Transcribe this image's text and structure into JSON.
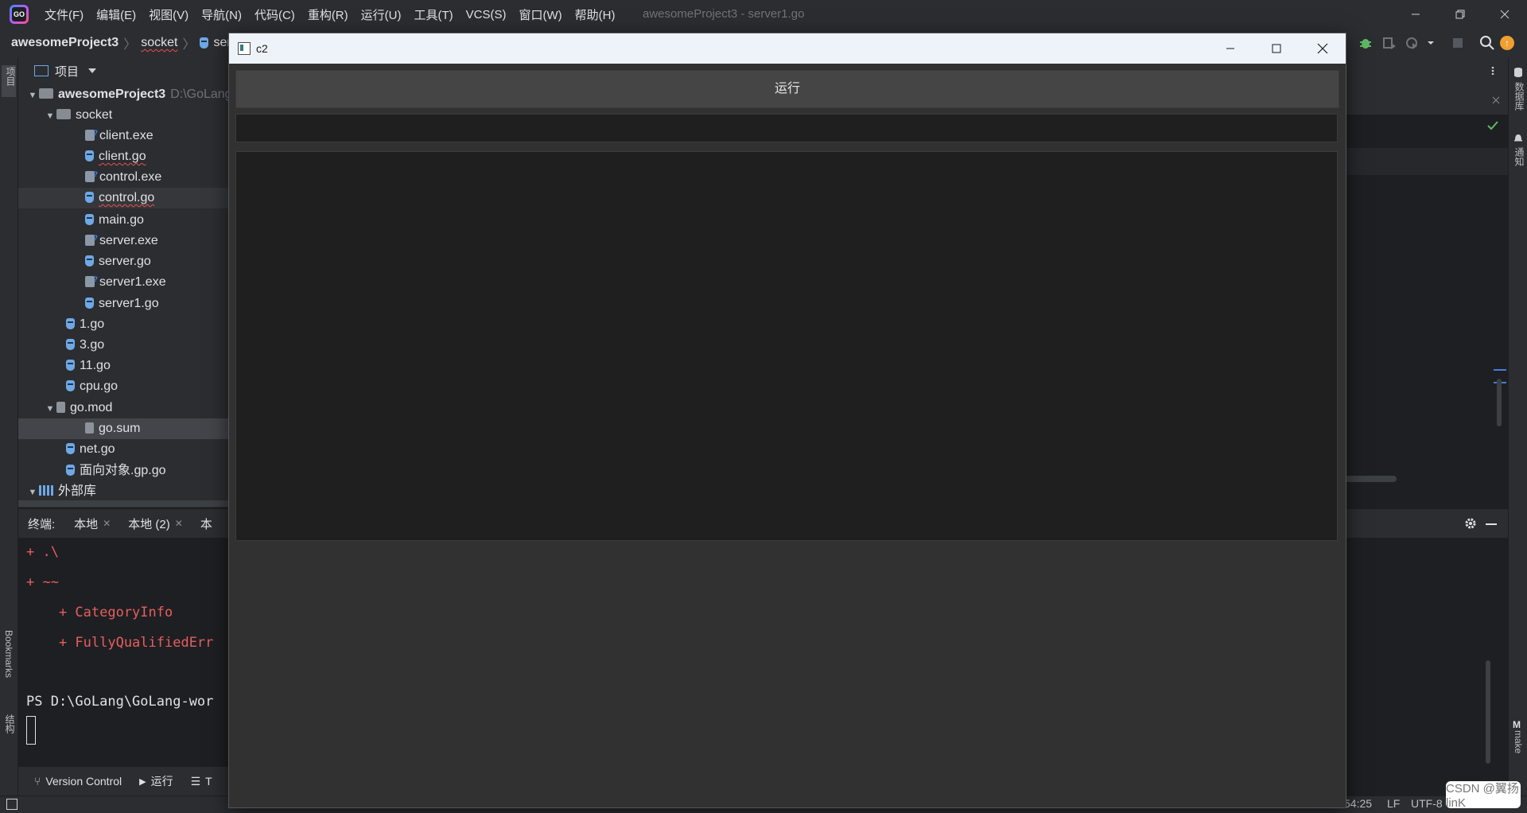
{
  "ide": {
    "logo_text": "GO",
    "menu": [
      "文件(F)",
      "编辑(E)",
      "视图(V)",
      "导航(N)",
      "代码(C)",
      "重构(R)",
      "运行(U)",
      "工具(T)",
      "VCS(S)",
      "窗口(W)",
      "帮助(H)"
    ],
    "window_title": "awesomeProject3 - server1.go",
    "breadcrumb": [
      "awesomeProject3",
      "socket",
      "serv"
    ],
    "left_stripe": {
      "project": "项目",
      "bookmarks": "Bookmarks",
      "structure": "结构"
    },
    "right_stripe": {
      "database": "数据库",
      "notifications": "通知",
      "make": "make"
    },
    "colors": {
      "accent": "#3d8bff",
      "error": "#e55f5f",
      "ok": "#5fb865"
    }
  },
  "project_panel": {
    "title": "项目",
    "root": {
      "name": "awesomeProject3",
      "path": "D:\\GoLang"
    },
    "items": [
      {
        "name": "socket",
        "kind": "folder",
        "level": 1,
        "expanded": true
      },
      {
        "name": "client.exe",
        "kind": "exe",
        "level": 2
      },
      {
        "name": "client.go",
        "kind": "go",
        "level": 2
      },
      {
        "name": "control.exe",
        "kind": "exe",
        "level": 2
      },
      {
        "name": "control.go",
        "kind": "go",
        "level": 2
      },
      {
        "name": "main.go",
        "kind": "go",
        "level": 2
      },
      {
        "name": "server.exe",
        "kind": "exe",
        "level": 2
      },
      {
        "name": "server.go",
        "kind": "go",
        "level": 2
      },
      {
        "name": "server1.exe",
        "kind": "exe",
        "level": 2
      },
      {
        "name": "server1.go",
        "kind": "go",
        "level": 2
      },
      {
        "name": "1.go",
        "kind": "go",
        "level": 1
      },
      {
        "name": "3.go",
        "kind": "go",
        "level": 1
      },
      {
        "name": "11.go",
        "kind": "go",
        "level": 1
      },
      {
        "name": "cpu.go",
        "kind": "go",
        "level": 1
      },
      {
        "name": "go.mod",
        "kind": "mod",
        "level": 1,
        "expanded": true
      },
      {
        "name": "go.sum",
        "kind": "txt",
        "level": 2,
        "selected": true
      },
      {
        "name": "net.go",
        "kind": "go",
        "level": 1
      },
      {
        "name": "面向对象.gp.go",
        "kind": "go",
        "level": 1
      },
      {
        "name": "外部库",
        "kind": "lib",
        "level": 0,
        "expanded": true
      }
    ]
  },
  "terminal": {
    "label": "终端:",
    "tabs": [
      "本地",
      "本地 (2)",
      "本"
    ],
    "lines": [
      "+ .\\",
      "+ ~~",
      "    + CategoryInfo",
      "    + FullyQualifiedErr"
    ],
    "prompt": "PS D:\\GoLang\\GoLang-wor"
  },
  "bottom_tools": {
    "version_control": "Version Control",
    "run": "运行",
    "todo": "T"
  },
  "status": {
    "position": "54:25",
    "line_sep": "LF",
    "encoding": "UTF-8"
  },
  "c2_window": {
    "title": "c2",
    "run_label": "运行",
    "input_value": "",
    "input_placeholder": "",
    "output_text": ""
  },
  "watermark": "CSDN @翼扬linK"
}
